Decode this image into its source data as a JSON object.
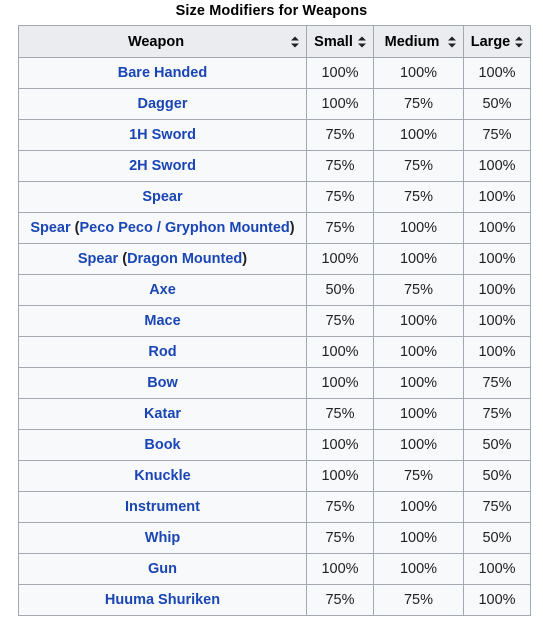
{
  "table": {
    "caption": "Size Modifiers for Weapons",
    "columns": [
      {
        "label": "Weapon",
        "sortable": true,
        "sort_icon": "sort-updown-icon"
      },
      {
        "label": "Small",
        "sortable": true,
        "sort_icon": "sort-updown-icon"
      },
      {
        "label": "Medium",
        "sortable": true,
        "sort_icon": "sort-updown-icon"
      },
      {
        "label": "Large",
        "sortable": true,
        "sort_icon": "sort-updown-icon"
      }
    ],
    "link_color": "#1a46b5",
    "header_bg": "#eaecf0",
    "row_bg": "#f8f9fa",
    "border_color": "#a2a9b1",
    "rows": [
      {
        "weapon": "Bare Handed",
        "parts": [
          {
            "text": "Bare Handed",
            "link": true
          }
        ],
        "small": "100%",
        "medium": "100%",
        "large": "100%"
      },
      {
        "weapon": "Dagger",
        "parts": [
          {
            "text": "Dagger",
            "link": true
          }
        ],
        "small": "100%",
        "medium": "75%",
        "large": "50%"
      },
      {
        "weapon": "1H Sword",
        "parts": [
          {
            "text": "1H Sword",
            "link": true
          }
        ],
        "small": "75%",
        "medium": "100%",
        "large": "75%"
      },
      {
        "weapon": "2H Sword",
        "parts": [
          {
            "text": "2H Sword",
            "link": true
          }
        ],
        "small": "75%",
        "medium": "75%",
        "large": "100%"
      },
      {
        "weapon": "Spear",
        "parts": [
          {
            "text": "Spear",
            "link": true
          }
        ],
        "small": "75%",
        "medium": "75%",
        "large": "100%"
      },
      {
        "weapon": "Spear (Peco Peco / Gryphon Mounted)",
        "parts": [
          {
            "text": "Spear",
            "link": true
          },
          {
            "text": " (",
            "link": false
          },
          {
            "text": "Peco Peco / Gryphon Mounted",
            "link": true
          },
          {
            "text": ")",
            "link": false
          }
        ],
        "small": "75%",
        "medium": "100%",
        "large": "100%"
      },
      {
        "weapon": "Spear (Dragon Mounted)",
        "parts": [
          {
            "text": "Spear",
            "link": true
          },
          {
            "text": " (",
            "link": false
          },
          {
            "text": "Dragon Mounted",
            "link": true
          },
          {
            "text": ")",
            "link": false
          }
        ],
        "small": "100%",
        "medium": "100%",
        "large": "100%"
      },
      {
        "weapon": "Axe",
        "parts": [
          {
            "text": "Axe",
            "link": true
          }
        ],
        "small": "50%",
        "medium": "75%",
        "large": "100%"
      },
      {
        "weapon": "Mace",
        "parts": [
          {
            "text": "Mace",
            "link": true
          }
        ],
        "small": "75%",
        "medium": "100%",
        "large": "100%"
      },
      {
        "weapon": "Rod",
        "parts": [
          {
            "text": "Rod",
            "link": true
          }
        ],
        "small": "100%",
        "medium": "100%",
        "large": "100%"
      },
      {
        "weapon": "Bow",
        "parts": [
          {
            "text": "Bow",
            "link": true
          }
        ],
        "small": "100%",
        "medium": "100%",
        "large": "75%"
      },
      {
        "weapon": "Katar",
        "parts": [
          {
            "text": "Katar",
            "link": true
          }
        ],
        "small": "75%",
        "medium": "100%",
        "large": "75%"
      },
      {
        "weapon": "Book",
        "parts": [
          {
            "text": "Book",
            "link": true
          }
        ],
        "small": "100%",
        "medium": "100%",
        "large": "50%"
      },
      {
        "weapon": "Knuckle",
        "parts": [
          {
            "text": "Knuckle",
            "link": true
          }
        ],
        "small": "100%",
        "medium": "75%",
        "large": "50%"
      },
      {
        "weapon": "Instrument",
        "parts": [
          {
            "text": "Instrument",
            "link": true
          }
        ],
        "small": "75%",
        "medium": "100%",
        "large": "75%"
      },
      {
        "weapon": "Whip",
        "parts": [
          {
            "text": "Whip",
            "link": true
          }
        ],
        "small": "75%",
        "medium": "100%",
        "large": "50%"
      },
      {
        "weapon": "Gun",
        "parts": [
          {
            "text": "Gun",
            "link": true
          }
        ],
        "small": "100%",
        "medium": "100%",
        "large": "100%"
      },
      {
        "weapon": "Huuma Shuriken",
        "parts": [
          {
            "text": "Huuma Shuriken",
            "link": true
          }
        ],
        "small": "75%",
        "medium": "75%",
        "large": "100%"
      }
    ]
  }
}
